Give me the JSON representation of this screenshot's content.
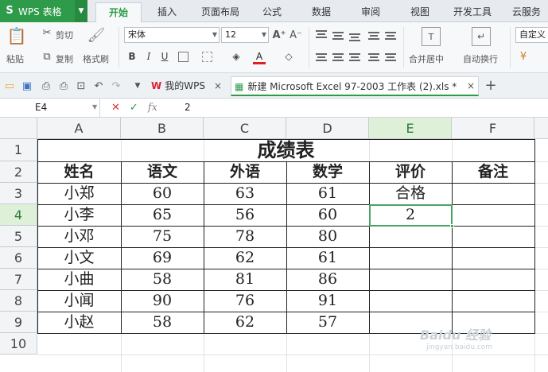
{
  "app": {
    "name": "WPS 表格"
  },
  "ribbon_tabs": [
    "开始",
    "插入",
    "页面布局",
    "公式",
    "数据",
    "审阅",
    "视图",
    "开发工具",
    "云服务"
  ],
  "active_tab": "开始",
  "toolbar": {
    "paste": "粘贴",
    "cut": "剪切",
    "copy": "复制",
    "format_painter": "格式刷",
    "font_name": "宋体",
    "font_size": "12",
    "merge_center": "合并居中",
    "wrap_text": "自动换行",
    "number_format": "自定义"
  },
  "doc_tabs": [
    {
      "label": "我的WPS"
    },
    {
      "label": "新建 Microsoft Excel 97-2003 工作表 (2).xls *"
    }
  ],
  "formula_bar": {
    "cell_ref": "E4",
    "value": "2"
  },
  "columns": [
    "A",
    "B",
    "C",
    "D",
    "E",
    "F"
  ],
  "rows": [
    "1",
    "2",
    "3",
    "4",
    "5",
    "6",
    "7",
    "8",
    "9",
    "10"
  ],
  "selected_cell": "E4",
  "sheet": {
    "title": "成绩表",
    "headers": [
      "姓名",
      "语文",
      "外语",
      "数学",
      "评价",
      "备注"
    ],
    "data": [
      [
        "小郑",
        "60",
        "63",
        "61",
        "合格",
        ""
      ],
      [
        "小李",
        "65",
        "56",
        "60",
        "2",
        ""
      ],
      [
        "小邓",
        "75",
        "78",
        "80",
        "",
        ""
      ],
      [
        "小文",
        "69",
        "62",
        "61",
        "",
        ""
      ],
      [
        "小曲",
        "58",
        "81",
        "86",
        "",
        ""
      ],
      [
        "小闻",
        "90",
        "76",
        "91",
        "",
        ""
      ],
      [
        "小赵",
        "58",
        "62",
        "57",
        "",
        ""
      ]
    ]
  },
  "watermark": {
    "text": "Baidu 经验",
    "sub": "jingyan.baidu.com"
  }
}
